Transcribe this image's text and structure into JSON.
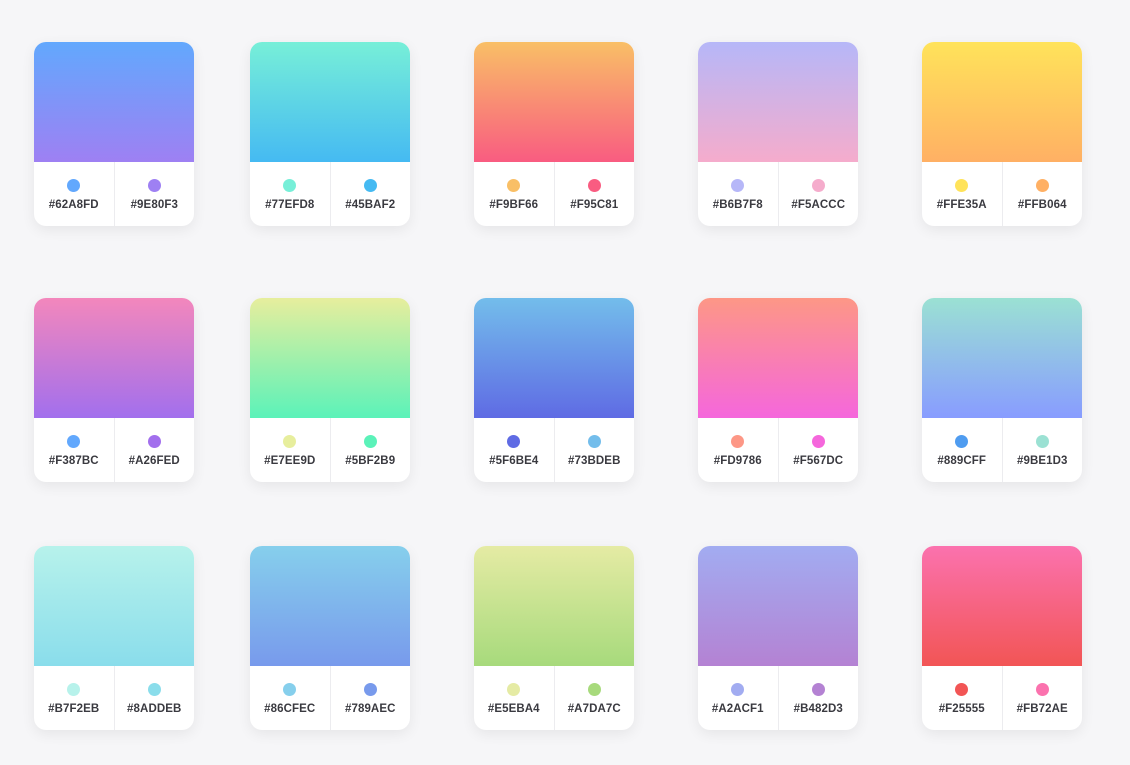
{
  "colors": [
    [
      "#62A8FD",
      "#9E80F3"
    ],
    [
      "#77EFD8",
      "#45BAF2"
    ],
    [
      "#F9BF66",
      "#F95C81"
    ],
    [
      "#B6B7F8",
      "#F5ACCC"
    ],
    [
      "#FFE35A",
      "#FFB064"
    ],
    [
      "#F387BC",
      "#A26FED"
    ],
    [
      "#E7EE9D",
      "#5BF2B9"
    ],
    [
      "#5F6BE4",
      "#73BDEB"
    ],
    [
      "#FD9786",
      "#F567DC"
    ],
    [
      "#889CFF",
      "#9BE1D3"
    ],
    [
      "#B7F2EB",
      "#8ADDEB"
    ],
    [
      "#86CFEC",
      "#789AEC"
    ],
    [
      "#E5EBA4",
      "#A7DA7C"
    ],
    [
      "#A2ACF1",
      "#B482D3"
    ],
    [
      "#F25555",
      "#FB72AE"
    ]
  ],
  "cards": [
    {
      "top": "#62A8FD",
      "bottom": "#9E80F3",
      "left": {
        "hex": "#62A8FD",
        "dot": "#62A8FD"
      },
      "right": {
        "hex": "#9E80F3",
        "dot": "#9E80F3"
      }
    },
    {
      "top": "#77EFD8",
      "bottom": "#45BAF2",
      "left": {
        "hex": "#77EFD8",
        "dot": "#77EFD8"
      },
      "right": {
        "hex": "#45BAF2",
        "dot": "#45BAF2"
      }
    },
    {
      "top": "#F9BF66",
      "bottom": "#F95C81",
      "left": {
        "hex": "#F9BF66",
        "dot": "#F9BF66"
      },
      "right": {
        "hex": "#F95C81",
        "dot": "#F95C81"
      }
    },
    {
      "top": "#B6B7F8",
      "bottom": "#F5ACCC",
      "left": {
        "hex": "#B6B7F8",
        "dot": "#B6B7F8"
      },
      "right": {
        "hex": "#F5ACCC",
        "dot": "#F5ACCC"
      }
    },
    {
      "top": "#FFE35A",
      "bottom": "#FFB064",
      "left": {
        "hex": "#FFE35A",
        "dot": "#FFE35A"
      },
      "right": {
        "hex": "#FFB064",
        "dot": "#FFB064"
      }
    },
    {
      "top": "#F387BC",
      "bottom": "#A26FED",
      "left": {
        "hex": "#F387BC",
        "dot": "#62A8FD"
      },
      "right": {
        "hex": "#A26FED",
        "dot": "#A26FED"
      }
    },
    {
      "top": "#E7EE9D",
      "bottom": "#5BF2B9",
      "left": {
        "hex": "#E7EE9D",
        "dot": "#E7EE9D"
      },
      "right": {
        "hex": "#5BF2B9",
        "dot": "#5BF2B9"
      }
    },
    {
      "top": "#73BDEB",
      "bottom": "#5F6BE4",
      "left": {
        "hex": "#5F6BE4",
        "dot": "#5F6BE4"
      },
      "right": {
        "hex": "#73BDEB",
        "dot": "#73BDEB"
      }
    },
    {
      "top": "#FD9786",
      "bottom": "#F567DC",
      "left": {
        "hex": "#FD9786",
        "dot": "#FD9786"
      },
      "right": {
        "hex": "#F567DC",
        "dot": "#F567DC"
      }
    },
    {
      "top": "#9BE1D3",
      "bottom": "#889CFF",
      "left": {
        "hex": "#889CFF",
        "dot": "#4F9CF0"
      },
      "right": {
        "hex": "#9BE1D3",
        "dot": "#9BE1D3"
      }
    },
    {
      "top": "#B7F2EB",
      "bottom": "#8ADDEB",
      "left": {
        "hex": "#B7F2EB",
        "dot": "#B7F2EB"
      },
      "right": {
        "hex": "#8ADDEB",
        "dot": "#8ADDEB"
      }
    },
    {
      "top": "#86CFEC",
      "bottom": "#789AEC",
      "left": {
        "hex": "#86CFEC",
        "dot": "#86CFEC"
      },
      "right": {
        "hex": "#789AEC",
        "dot": "#789AEC"
      }
    },
    {
      "top": "#E5EBA4",
      "bottom": "#A7DA7C",
      "left": {
        "hex": "#E5EBA4",
        "dot": "#E5EBA4"
      },
      "right": {
        "hex": "#A7DA7C",
        "dot": "#A7DA7C"
      }
    },
    {
      "top": "#A2ACF1",
      "bottom": "#B482D3",
      "left": {
        "hex": "#A2ACF1",
        "dot": "#A2ACF1"
      },
      "right": {
        "hex": "#B482D3",
        "dot": "#B482D3"
      }
    },
    {
      "top": "#FB72AE",
      "bottom": "#F25555",
      "left": {
        "hex": "#F25555",
        "dot": "#F25555"
      },
      "right": {
        "hex": "#FB72AE",
        "dot": "#FB72AE"
      }
    }
  ]
}
